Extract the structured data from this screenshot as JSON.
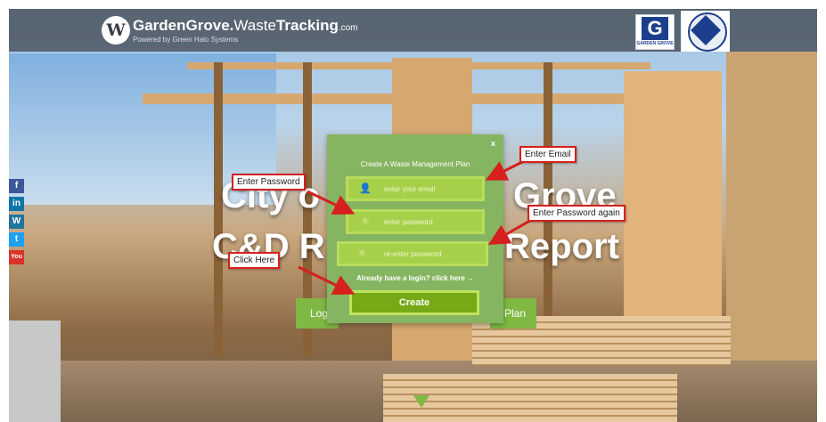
{
  "header": {
    "brand_bold": "GardenGrove.",
    "brand_thin": "Waste",
    "brand_bold2": "Tracking",
    "brand_suffix": ".com",
    "tagline": "Powered by Green Halo Systems",
    "logo_glyph": "W",
    "city_logo_letter": "G",
    "city_logo_caption": "GARDEN GROVE"
  },
  "social": [
    "f",
    "in",
    "W",
    "t",
    "You"
  ],
  "hero": {
    "line1_left": "City o",
    "line1_right": "Grove",
    "line2_left": "C&D R",
    "line2_right": "Report"
  },
  "background_buttons": {
    "left": "Log",
    "right": "Plan"
  },
  "modal": {
    "title": "Create A Waste Management Plan",
    "close": "x",
    "email_placeholder": "enter your email",
    "password_placeholder": "enter password",
    "repassword_placeholder": "re-enter password",
    "login_link": "Already have a login? click here →",
    "create_button": "Create"
  },
  "callouts": {
    "email": "Enter Email",
    "password": "Enter Password",
    "password_again": "Enter Password again",
    "click_here": "Click Here"
  },
  "colors": {
    "accent_green": "#7fb944",
    "modal_green": "#85b560",
    "field_green": "#a6d04a",
    "callout_border": "#d6201d"
  }
}
